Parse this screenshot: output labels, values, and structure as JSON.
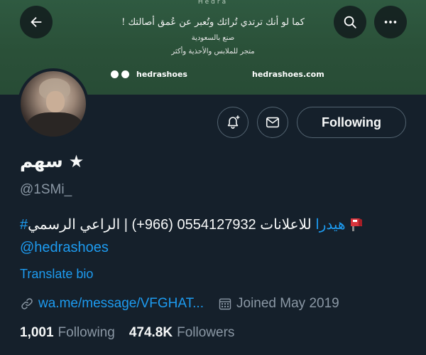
{
  "banner": {
    "brand_top": "Hedra",
    "tagline": "كما لو أنك ترتدي تُراثك وتُعبر عن عُمق أصالتك !",
    "line2": "صنع بالسعودية",
    "line3": "متجر للملابس والأحذية وأكثر",
    "social_handle": "hedrashoes",
    "website": "hedrashoes.com"
  },
  "header": {
    "back_icon": "arrow-left-icon",
    "search_icon": "search-icon",
    "more_icon": "more-horizontal-icon"
  },
  "actions": {
    "notify_icon": "bell-plus-icon",
    "message_icon": "envelope-icon",
    "following_label": "Following"
  },
  "profile": {
    "display_name": "سهم",
    "star": "★",
    "handle": "@1SMi_",
    "bio_line1": "للاعلانات 0554127932 (966+) | الراعي الرسمي ",
    "bio_hashtag": "#هيدرا",
    "bio_mention": "@hedrashoes",
    "translate_label": "Translate bio",
    "url": "wa.me/message/VFGHAT...",
    "joined": "Joined May 2019"
  },
  "stats": {
    "following_count": "1,001",
    "following_label": "Following",
    "followers_count": "474.8K",
    "followers_label": "Followers"
  },
  "colors": {
    "background": "#15202b",
    "banner": "#2d5640",
    "accent": "#1d9bf0",
    "secondary_text": "#8b98a5"
  }
}
